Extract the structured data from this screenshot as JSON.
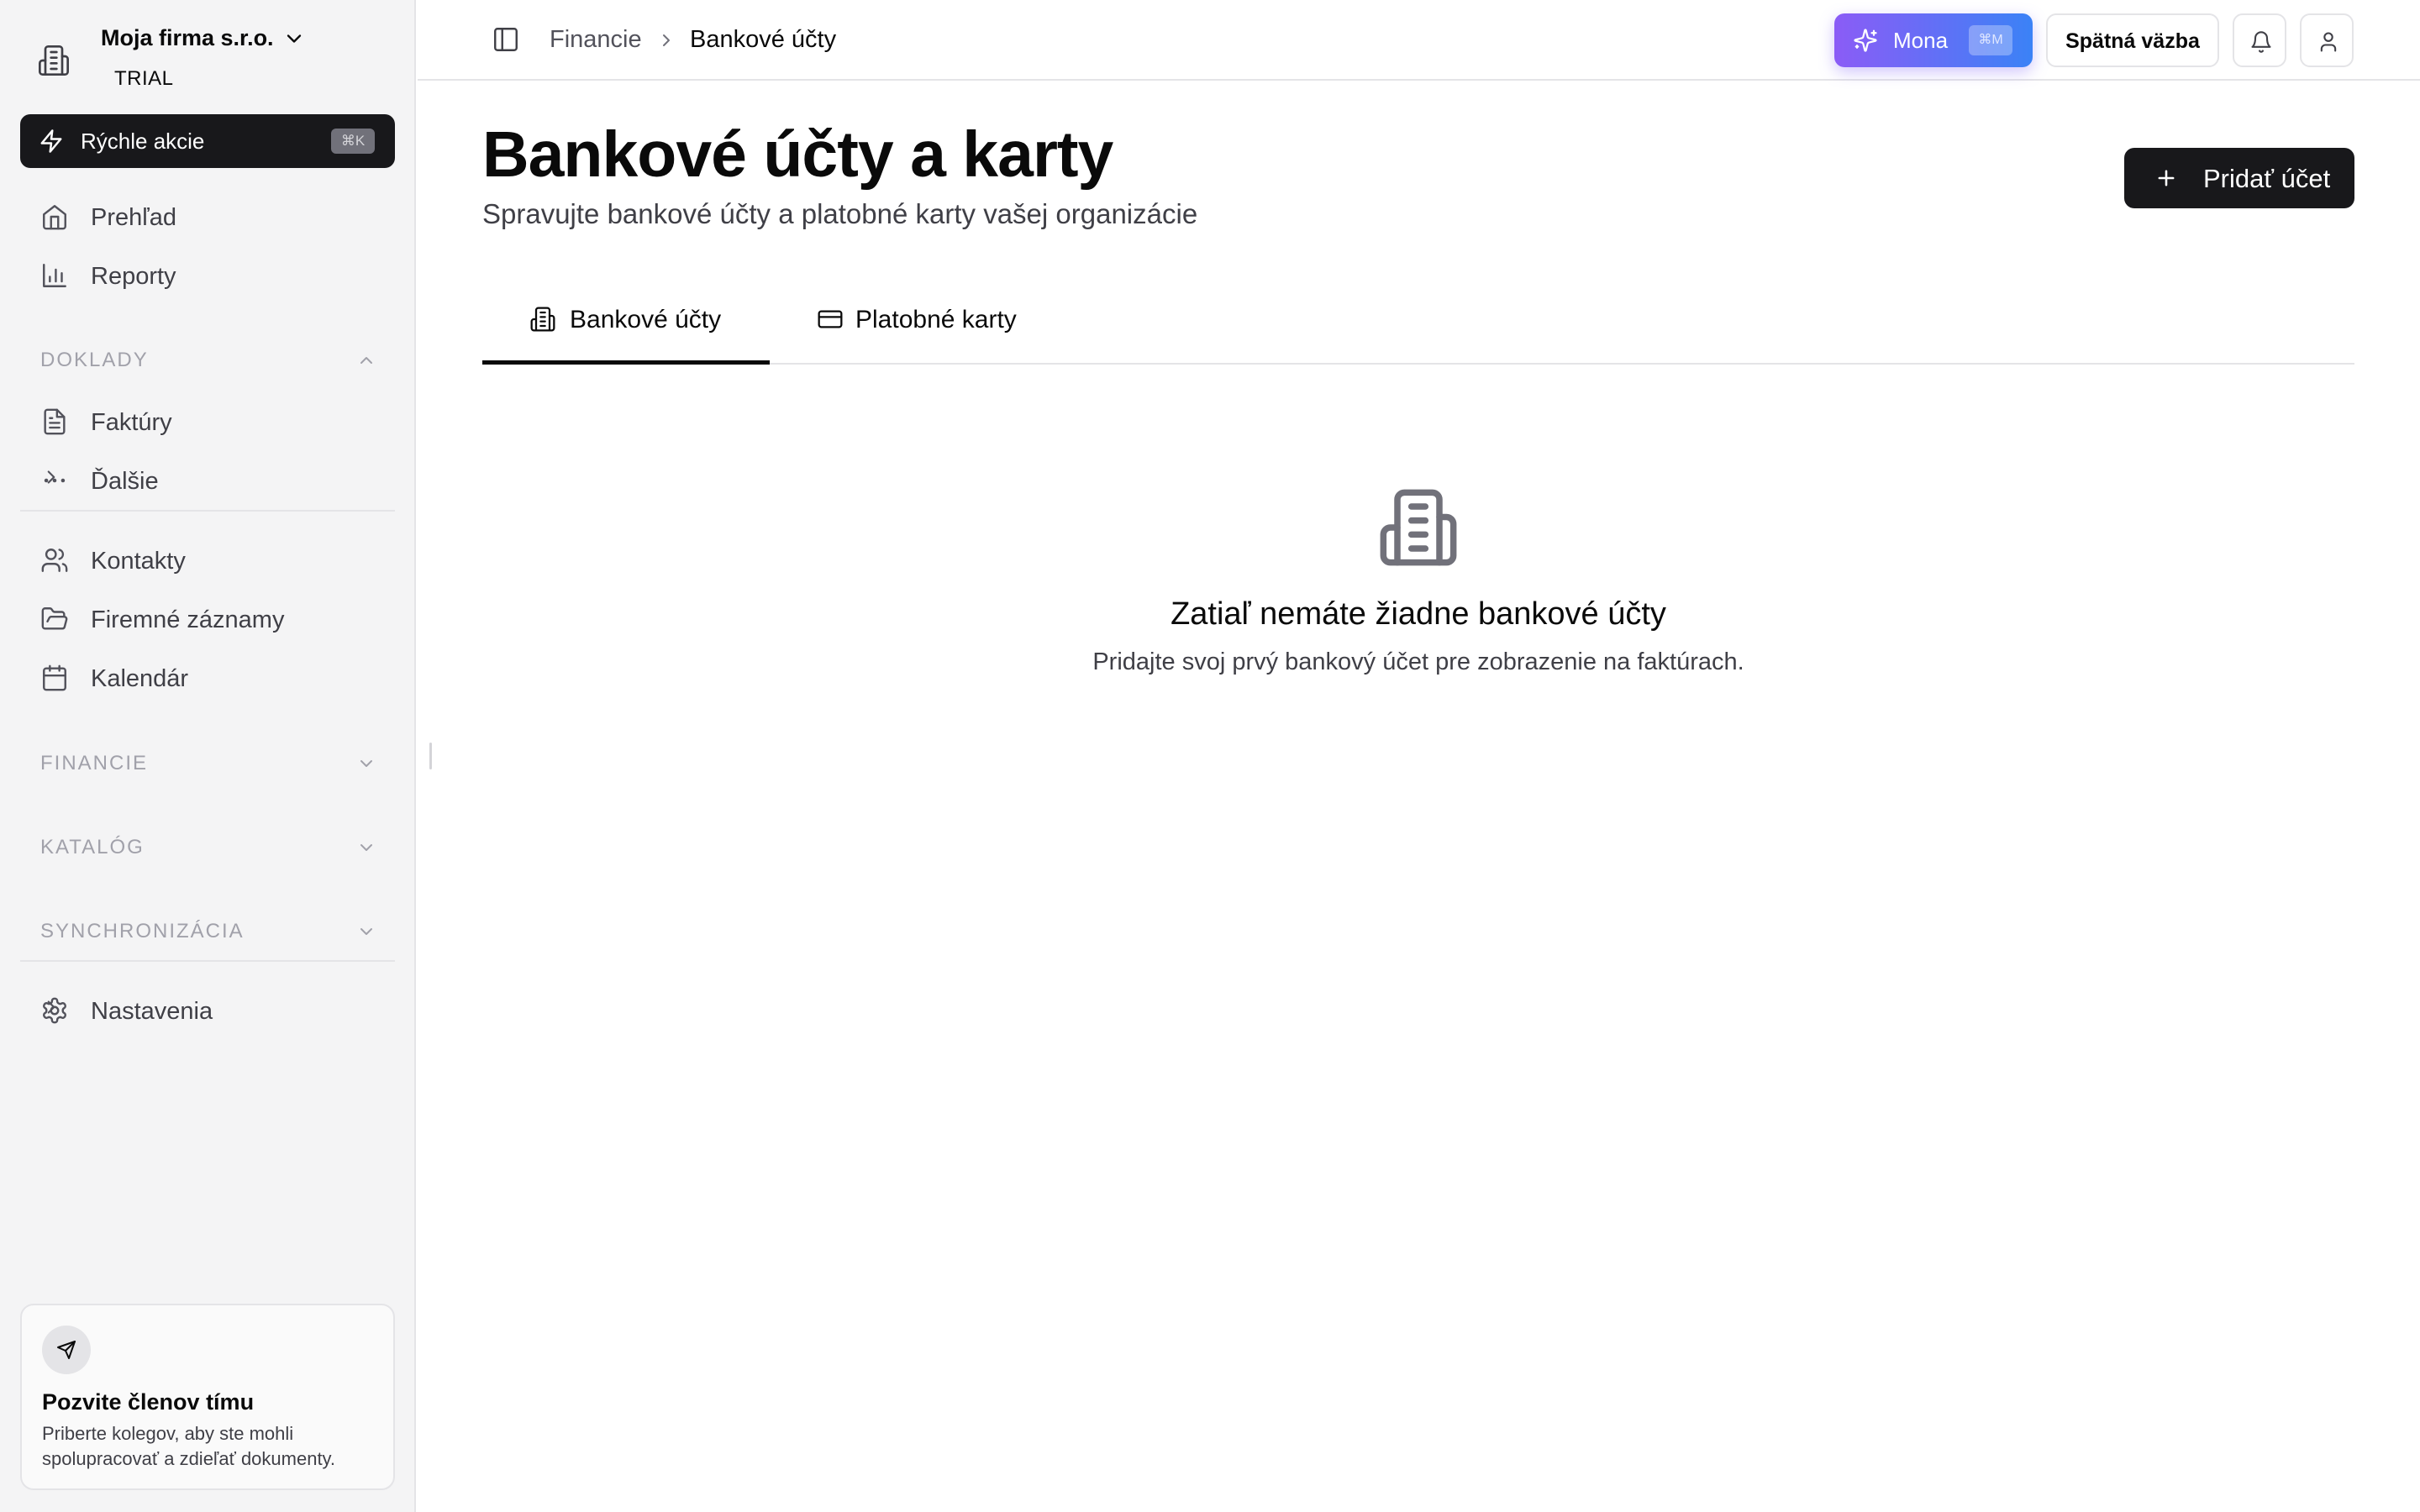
{
  "sidebar": {
    "org_name": "Moja firma s.r.o.",
    "org_plan": "TRIAL",
    "quick_actions": {
      "label": "Rýchle akcie",
      "shortcut": "⌘K"
    },
    "nav_top": [
      {
        "label": "Prehľad",
        "icon": "home-icon"
      },
      {
        "label": "Reporty",
        "icon": "bar-chart-icon"
      }
    ],
    "sections": {
      "doklady": "DOKLADY",
      "financie": "FINANCIE",
      "katalog": "KATALÓG",
      "synchronizacia": "SYNCHRONIZÁCIA"
    },
    "doklady_items": [
      {
        "label": "Faktúry",
        "icon": "document-icon"
      },
      {
        "label": "Ďalšie",
        "icon": "more-icon"
      }
    ],
    "nav_middle": [
      {
        "label": "Kontakty",
        "icon": "users-icon"
      },
      {
        "label": "Firemné záznamy",
        "icon": "folder-icon"
      },
      {
        "label": "Kalendár",
        "icon": "calendar-icon"
      }
    ],
    "settings": {
      "label": "Nastavenia",
      "icon": "gear-icon"
    },
    "invite": {
      "title": "Pozvite členov tímu",
      "text": "Priberte kolegov, aby ste mohli spolupracovať a zdieľať dokumenty."
    }
  },
  "topbar": {
    "breadcrumb": [
      "Financie",
      "Bankové účty"
    ],
    "mona": {
      "label": "Mona",
      "shortcut": "⌘M"
    },
    "feedback_label": "Spätná väzba"
  },
  "main": {
    "title": "Bankové účty a karty",
    "subtitle": "Spravujte bankové účty a platobné karty vašej organizácie",
    "add_button": "Pridať účet",
    "tabs": [
      {
        "label": "Bankové účty",
        "active": true
      },
      {
        "label": "Platobné karty",
        "active": false
      }
    ],
    "empty": {
      "title": "Zatiaľ nemáte žiadne bankové účty",
      "text": "Pridajte svoj prvý bankový účet pre zobrazenie na faktúrach."
    }
  },
  "colors": {
    "sidebar_bg": "#f4f4f5",
    "primary_dark": "#18181b",
    "mona_gradient_start": "#8b5cf6",
    "mona_gradient_end": "#3b82f6",
    "muted_text": "#a1a1aa"
  }
}
